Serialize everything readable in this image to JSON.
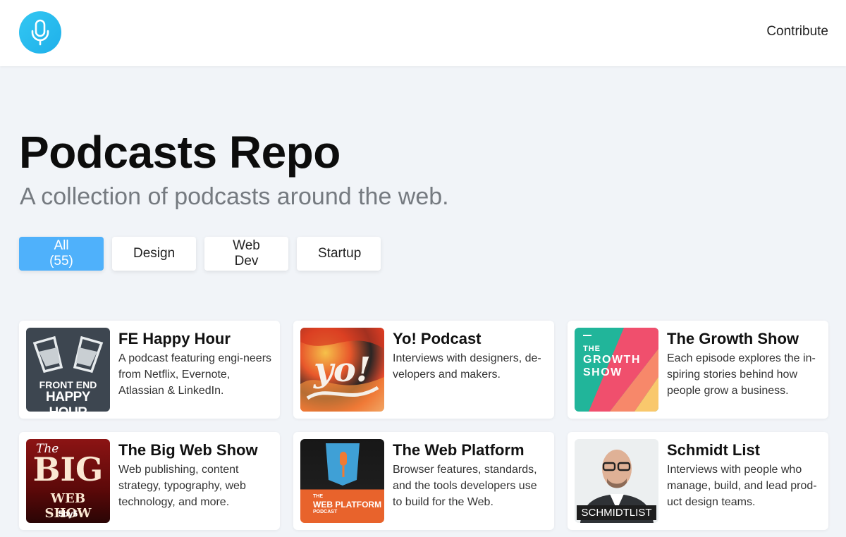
{
  "header": {
    "logo_icon": "microphone-icon",
    "contribute_label": "Contribute"
  },
  "hero": {
    "title": "Podcasts Repo",
    "subtitle": "A collection of podcasts around the web."
  },
  "filters": [
    {
      "label": "All (55)",
      "active": true
    },
    {
      "label": "Design",
      "active": false
    },
    {
      "label": "Web Dev",
      "active": false
    },
    {
      "label": "Startup",
      "active": false
    }
  ],
  "podcasts": [
    {
      "title": "FE Happy Hour",
      "description": "A podcast featuring engi-neers from Netflix, Evernote, Atlassian & LinkedIn.",
      "art_line1": "FRONT END",
      "art_line2": "HAPPY HOUR"
    },
    {
      "title": "Yo! Podcast",
      "description": "Interviews with designers, de-velopers and makers.",
      "art_line1": "yo!"
    },
    {
      "title": "The Growth Show",
      "description": "Each episode explores the in-spiring stories behind how people grow a business.",
      "art_line1": "THE",
      "art_line2": "GROWTH",
      "art_line3": "SHOW"
    },
    {
      "title": "The Big Web Show",
      "description": "Web publishing, content strategy, typography, web technology, and more.",
      "art_line1": "The",
      "art_line2": "BIG",
      "art_line3": "WEB SHOW",
      "art_line4": "5by5"
    },
    {
      "title": "The Web Platform",
      "description": "Browser features, standards, and the tools developers use to build for the Web.",
      "art_line1": "THE",
      "art_line2": "WEB PLATFORM",
      "art_line3": "PODCAST"
    },
    {
      "title": "Schmidt List",
      "description": "Interviews with people who manage, build, and lead prod-uct design teams.",
      "art_line1": "SCHMIDTLIST"
    }
  ],
  "colors": {
    "accent": "#4fb1fb",
    "logo": "#26b9ee",
    "background": "#f1f4f8"
  }
}
